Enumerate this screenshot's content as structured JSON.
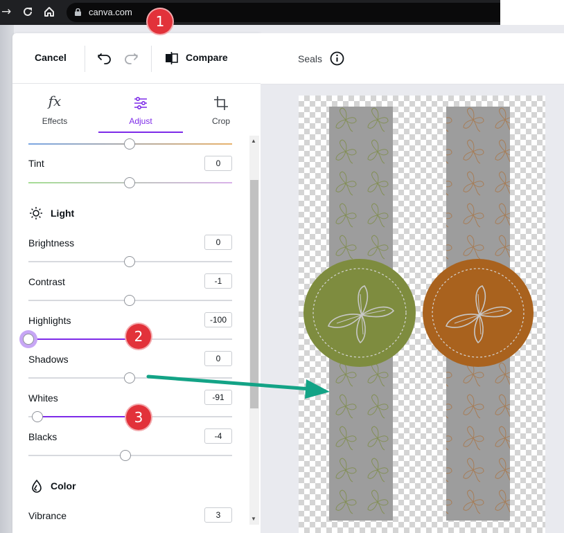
{
  "browser": {
    "url": "canva.com",
    "icons": [
      "arrow-forward-icon",
      "reload-icon",
      "home-icon",
      "lock-icon"
    ]
  },
  "header": {
    "cancel_label": "Cancel",
    "compare_label": "Compare",
    "doc_title": "Seals",
    "icons": [
      "undo-icon",
      "redo-icon",
      "compare-icon",
      "info-icon"
    ]
  },
  "tabs": [
    {
      "label": "Effects",
      "icon": "fx-icon",
      "active": false
    },
    {
      "label": "Adjust",
      "icon": "sliders-icon",
      "active": true
    },
    {
      "label": "Crop",
      "icon": "crop-icon",
      "active": false
    }
  ],
  "adjust": {
    "tint": {
      "label": "Tint",
      "value": "0"
    },
    "light_section": "Light",
    "brightness": {
      "label": "Brightness",
      "value": "0"
    },
    "contrast": {
      "label": "Contrast",
      "value": "-1"
    },
    "highlights": {
      "label": "Highlights",
      "value": "-100"
    },
    "shadows": {
      "label": "Shadows",
      "value": "0"
    },
    "whites": {
      "label": "Whites",
      "value": "-91"
    },
    "blacks": {
      "label": "Blacks",
      "value": "-4"
    },
    "color_section": "Color",
    "vibrance": {
      "label": "Vibrance",
      "value": "3"
    }
  },
  "badges": {
    "one": "1",
    "two": "2",
    "three": "3"
  },
  "colors": {
    "accent": "#7d2ae8",
    "badge": "#e2323a",
    "arrow": "#13a386",
    "green_seal": "#7e8c3f",
    "orange_seal": "#a9621e",
    "strip": "#9d9d9d"
  }
}
